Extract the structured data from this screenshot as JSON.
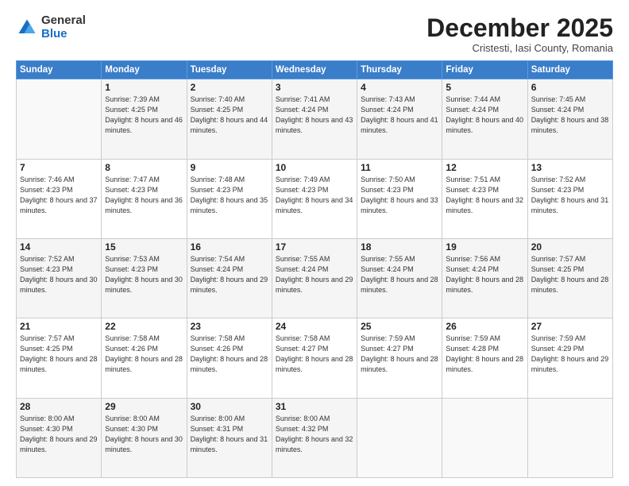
{
  "logo": {
    "general": "General",
    "blue": "Blue"
  },
  "header": {
    "month": "December 2025",
    "location": "Cristesti, Iasi County, Romania"
  },
  "weekdays": [
    "Sunday",
    "Monday",
    "Tuesday",
    "Wednesday",
    "Thursday",
    "Friday",
    "Saturday"
  ],
  "weeks": [
    [
      {
        "day": "",
        "sunrise": "",
        "sunset": "",
        "daylight": ""
      },
      {
        "day": "1",
        "sunrise": "Sunrise: 7:39 AM",
        "sunset": "Sunset: 4:25 PM",
        "daylight": "Daylight: 8 hours and 46 minutes."
      },
      {
        "day": "2",
        "sunrise": "Sunrise: 7:40 AM",
        "sunset": "Sunset: 4:25 PM",
        "daylight": "Daylight: 8 hours and 44 minutes."
      },
      {
        "day": "3",
        "sunrise": "Sunrise: 7:41 AM",
        "sunset": "Sunset: 4:24 PM",
        "daylight": "Daylight: 8 hours and 43 minutes."
      },
      {
        "day": "4",
        "sunrise": "Sunrise: 7:43 AM",
        "sunset": "Sunset: 4:24 PM",
        "daylight": "Daylight: 8 hours and 41 minutes."
      },
      {
        "day": "5",
        "sunrise": "Sunrise: 7:44 AM",
        "sunset": "Sunset: 4:24 PM",
        "daylight": "Daylight: 8 hours and 40 minutes."
      },
      {
        "day": "6",
        "sunrise": "Sunrise: 7:45 AM",
        "sunset": "Sunset: 4:24 PM",
        "daylight": "Daylight: 8 hours and 38 minutes."
      }
    ],
    [
      {
        "day": "7",
        "sunrise": "Sunrise: 7:46 AM",
        "sunset": "Sunset: 4:23 PM",
        "daylight": "Daylight: 8 hours and 37 minutes."
      },
      {
        "day": "8",
        "sunrise": "Sunrise: 7:47 AM",
        "sunset": "Sunset: 4:23 PM",
        "daylight": "Daylight: 8 hours and 36 minutes."
      },
      {
        "day": "9",
        "sunrise": "Sunrise: 7:48 AM",
        "sunset": "Sunset: 4:23 PM",
        "daylight": "Daylight: 8 hours and 35 minutes."
      },
      {
        "day": "10",
        "sunrise": "Sunrise: 7:49 AM",
        "sunset": "Sunset: 4:23 PM",
        "daylight": "Daylight: 8 hours and 34 minutes."
      },
      {
        "day": "11",
        "sunrise": "Sunrise: 7:50 AM",
        "sunset": "Sunset: 4:23 PM",
        "daylight": "Daylight: 8 hours and 33 minutes."
      },
      {
        "day": "12",
        "sunrise": "Sunrise: 7:51 AM",
        "sunset": "Sunset: 4:23 PM",
        "daylight": "Daylight: 8 hours and 32 minutes."
      },
      {
        "day": "13",
        "sunrise": "Sunrise: 7:52 AM",
        "sunset": "Sunset: 4:23 PM",
        "daylight": "Daylight: 8 hours and 31 minutes."
      }
    ],
    [
      {
        "day": "14",
        "sunrise": "Sunrise: 7:52 AM",
        "sunset": "Sunset: 4:23 PM",
        "daylight": "Daylight: 8 hours and 30 minutes."
      },
      {
        "day": "15",
        "sunrise": "Sunrise: 7:53 AM",
        "sunset": "Sunset: 4:23 PM",
        "daylight": "Daylight: 8 hours and 30 minutes."
      },
      {
        "day": "16",
        "sunrise": "Sunrise: 7:54 AM",
        "sunset": "Sunset: 4:24 PM",
        "daylight": "Daylight: 8 hours and 29 minutes."
      },
      {
        "day": "17",
        "sunrise": "Sunrise: 7:55 AM",
        "sunset": "Sunset: 4:24 PM",
        "daylight": "Daylight: 8 hours and 29 minutes."
      },
      {
        "day": "18",
        "sunrise": "Sunrise: 7:55 AM",
        "sunset": "Sunset: 4:24 PM",
        "daylight": "Daylight: 8 hours and 28 minutes."
      },
      {
        "day": "19",
        "sunrise": "Sunrise: 7:56 AM",
        "sunset": "Sunset: 4:24 PM",
        "daylight": "Daylight: 8 hours and 28 minutes."
      },
      {
        "day": "20",
        "sunrise": "Sunrise: 7:57 AM",
        "sunset": "Sunset: 4:25 PM",
        "daylight": "Daylight: 8 hours and 28 minutes."
      }
    ],
    [
      {
        "day": "21",
        "sunrise": "Sunrise: 7:57 AM",
        "sunset": "Sunset: 4:25 PM",
        "daylight": "Daylight: 8 hours and 28 minutes."
      },
      {
        "day": "22",
        "sunrise": "Sunrise: 7:58 AM",
        "sunset": "Sunset: 4:26 PM",
        "daylight": "Daylight: 8 hours and 28 minutes."
      },
      {
        "day": "23",
        "sunrise": "Sunrise: 7:58 AM",
        "sunset": "Sunset: 4:26 PM",
        "daylight": "Daylight: 8 hours and 28 minutes."
      },
      {
        "day": "24",
        "sunrise": "Sunrise: 7:58 AM",
        "sunset": "Sunset: 4:27 PM",
        "daylight": "Daylight: 8 hours and 28 minutes."
      },
      {
        "day": "25",
        "sunrise": "Sunrise: 7:59 AM",
        "sunset": "Sunset: 4:27 PM",
        "daylight": "Daylight: 8 hours and 28 minutes."
      },
      {
        "day": "26",
        "sunrise": "Sunrise: 7:59 AM",
        "sunset": "Sunset: 4:28 PM",
        "daylight": "Daylight: 8 hours and 28 minutes."
      },
      {
        "day": "27",
        "sunrise": "Sunrise: 7:59 AM",
        "sunset": "Sunset: 4:29 PM",
        "daylight": "Daylight: 8 hours and 29 minutes."
      }
    ],
    [
      {
        "day": "28",
        "sunrise": "Sunrise: 8:00 AM",
        "sunset": "Sunset: 4:30 PM",
        "daylight": "Daylight: 8 hours and 29 minutes."
      },
      {
        "day": "29",
        "sunrise": "Sunrise: 8:00 AM",
        "sunset": "Sunset: 4:30 PM",
        "daylight": "Daylight: 8 hours and 30 minutes."
      },
      {
        "day": "30",
        "sunrise": "Sunrise: 8:00 AM",
        "sunset": "Sunset: 4:31 PM",
        "daylight": "Daylight: 8 hours and 31 minutes."
      },
      {
        "day": "31",
        "sunrise": "Sunrise: 8:00 AM",
        "sunset": "Sunset: 4:32 PM",
        "daylight": "Daylight: 8 hours and 32 minutes."
      },
      {
        "day": "",
        "sunrise": "",
        "sunset": "",
        "daylight": ""
      },
      {
        "day": "",
        "sunrise": "",
        "sunset": "",
        "daylight": ""
      },
      {
        "day": "",
        "sunrise": "",
        "sunset": "",
        "daylight": ""
      }
    ]
  ]
}
